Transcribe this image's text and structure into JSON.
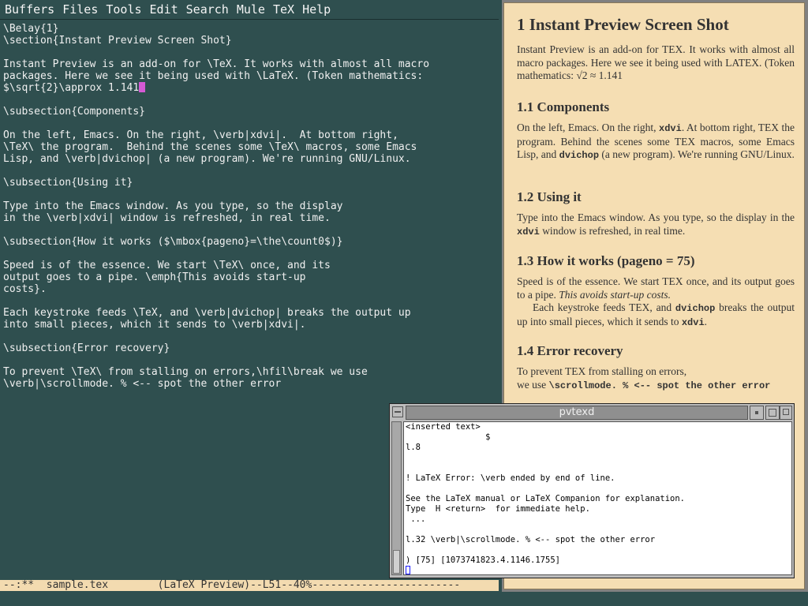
{
  "menubar": {
    "items": [
      "Buffers",
      "Files",
      "Tools",
      "Edit",
      "Search",
      "Mule",
      "TeX",
      "Help"
    ]
  },
  "emacs": {
    "lines": [
      "\\Belay{1}",
      "\\section{Instant Preview Screen Shot}",
      "",
      "Instant Preview is an add-on for \\TeX. It works with almost all macro",
      "packages. Here we see it being used with \\LaTeX. (Token mathematics:",
      "$\\sqrt{2}\\approx 1.141",
      "",
      "\\subsection{Components}",
      "",
      "On the left, Emacs. On the right, \\verb|xdvi|.  At bottom right,",
      "\\TeX\\ the program.  Behind the scenes some \\TeX\\ macros, some Emacs",
      "Lisp, and \\verb|dvichop| (a new program). We're running GNU/Linux.",
      "",
      "\\subsection{Using it}",
      "",
      "Type into the Emacs window. As you type, so the display",
      "in the \\verb|xdvi| window is refreshed, in real time.",
      "",
      "\\subsection{How it works ($\\mbox{pageno}=\\the\\count0$)}",
      "",
      "Speed is of the essence. We start \\TeX\\ once, and its",
      "output goes to a pipe. \\emph{This avoids start-up",
      "costs}.",
      "",
      "Each keystroke feeds \\TeX, and \\verb|dvichop| breaks the output up",
      "into small pieces, which it sends to \\verb|xdvi|.",
      "",
      "\\subsection{Error recovery}",
      "",
      "To prevent \\TeX\\ from stalling on errors,\\hfil\\break we use",
      "\\verb|\\scrollmode. % <-- spot the other error"
    ],
    "modeline": "--:**  sample.tex        (LaTeX Preview)--L51--40%------------------------"
  },
  "preview": {
    "section": "1   Instant Preview Screen Shot",
    "intro_1": "Instant Preview is an add-on for TEX. It works with almost all macro packages. Here we see it being used with LATEX. (Token mathematics: ",
    "intro_math": "√2 ≈ 1.141",
    "sub1": "1.1   Components",
    "comp_a": "On the left, Emacs. On the right, ",
    "comp_tt1": "xdvi",
    "comp_b": ". At bottom right, TEX the program.  Behind the scenes some TEX macros, some Emacs Lisp, and ",
    "comp_tt2": "dvichop",
    "comp_c": " (a new program).  We're running GNU/Linux.",
    "sub2": "1.2   Using it",
    "using_a": "Type into the Emacs window. As you type, so the display in the ",
    "using_tt": "xdvi",
    "using_b": " window is refreshed, in real time.",
    "sub3": "1.3   How it works (pageno = 75)",
    "how_a": "Speed is of the essence. We start TEX once, and its output goes to a pipe. ",
    "how_em": "This avoids start-up costs.",
    "how_b": "Each keystroke feeds TEX, and ",
    "how_tt1": "dvichop",
    "how_c": " breaks the output up into small pieces, which it sends to ",
    "how_tt2": "xdvi",
    "how_d": ".",
    "sub4": "1.4   Error recovery",
    "err_a": "To prevent TEX from stalling on errors,",
    "err_b": "we use ",
    "err_tt": "\\scrollmode. % <-- spot the other error"
  },
  "pvtexd": {
    "title": "pvtexd",
    "lines": [
      "<inserted text>",
      "                $",
      "l.8",
      "",
      "",
      "! LaTeX Error: \\verb ended by end of line.",
      "",
      "See the LaTeX manual or LaTeX Companion for explanation.",
      "Type  H <return>  for immediate help.",
      " ...",
      "",
      "l.32 \\verb|\\scrollmode. % <-- spot the other error",
      "",
      ") [75] [1073741823.4.1146.1755]"
    ]
  }
}
